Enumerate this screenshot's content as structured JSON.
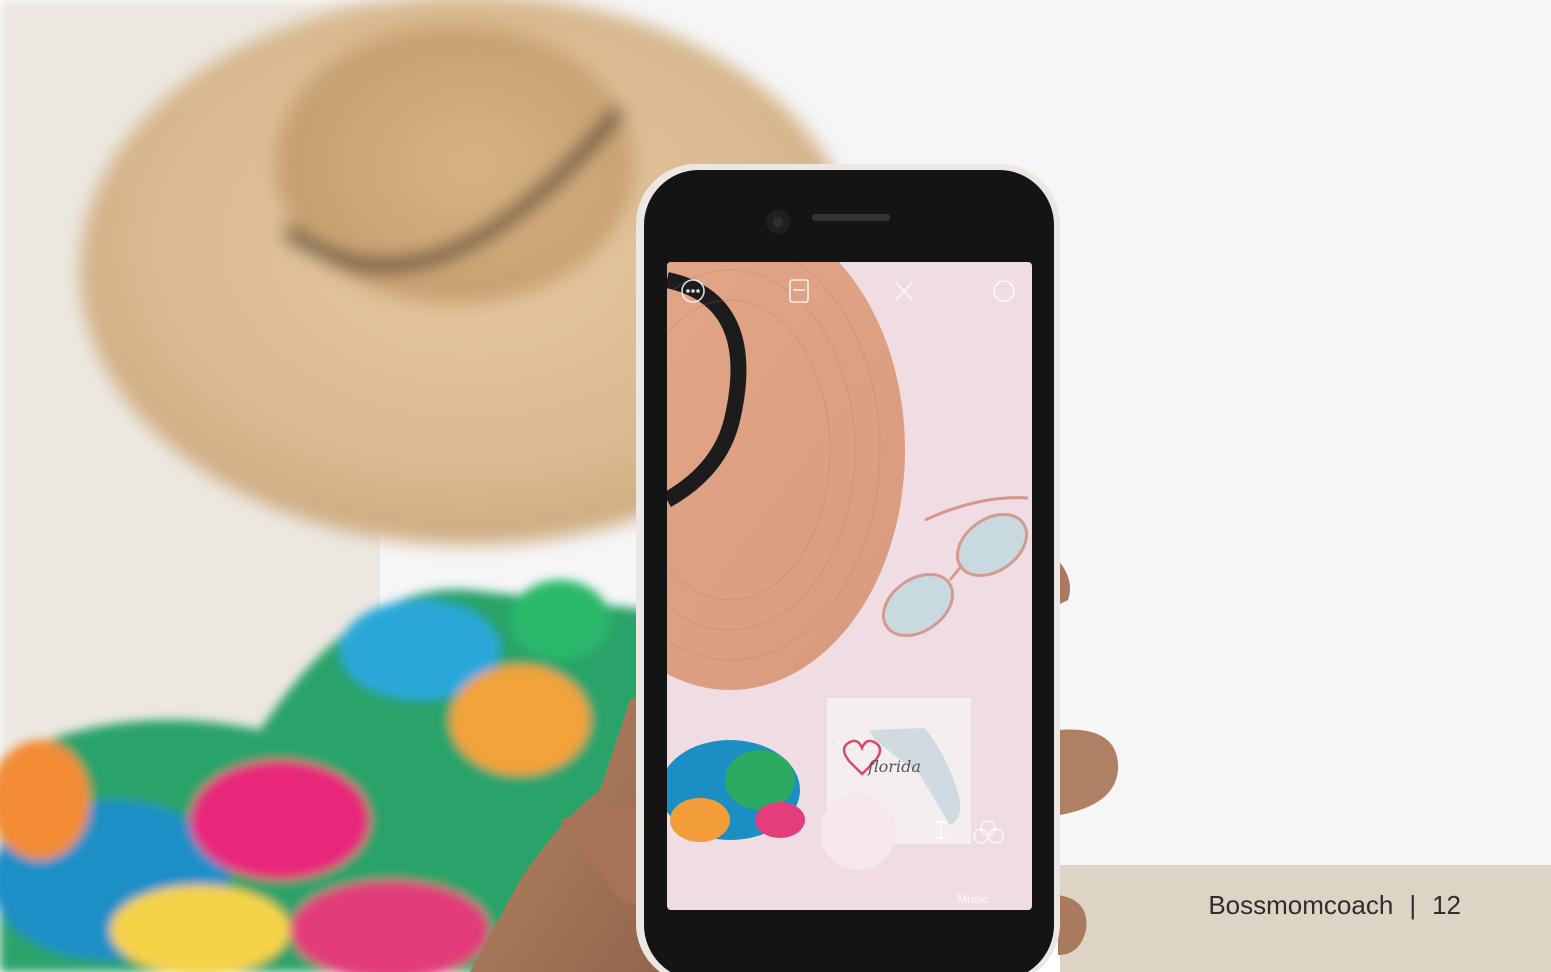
{
  "footer": {
    "brand": "Bossmomcoach",
    "separator": "|",
    "page_number": "12"
  },
  "photo": {
    "mini_card_text": "florida"
  },
  "camera_ui": {
    "icons": [
      "more-icon",
      "gallery-icon",
      "flash-icon",
      "switch-camera-icon",
      "shutter-button",
      "effects-icon"
    ],
    "mode_labels": [
      "Music"
    ]
  },
  "colors": {
    "background": "#ffffff",
    "hat": "#d8b88e",
    "phone_screen_bg": "#f0dde4",
    "accent_pink": "#d94a6a"
  }
}
